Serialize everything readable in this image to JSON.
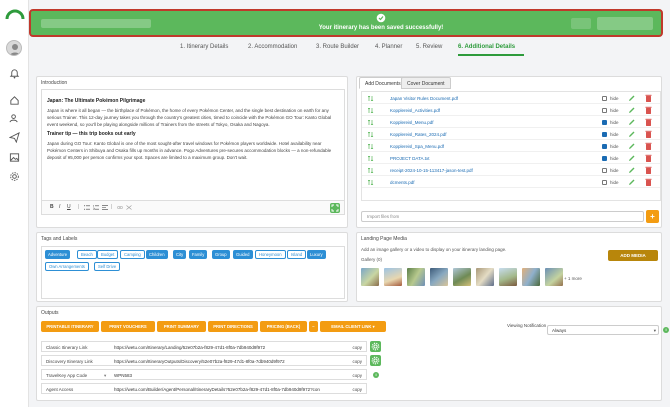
{
  "toast": {
    "message": "Your itinerary has been saved successfully!"
  },
  "steps": [
    {
      "label": "1. Itinerary Details"
    },
    {
      "label": "2. Accommodation"
    },
    {
      "label": "3. Route Builder"
    },
    {
      "label": "4. Planner"
    },
    {
      "label": "5. Review"
    },
    {
      "label": "6. Additional Details"
    }
  ],
  "introduction": {
    "title": "Introduction",
    "heading": "Japan: The Ultimate Pokémon Pilgrimage",
    "para1": "Japan is where it all began — the birthplace of Pokémon, the home of every Pokémon Center, and the single best destination on earth for any serious Trainer. This 12-day journey takes you through the country's greatest cities, timed to coincide with the Pokémon GO Tour: Kanto Global event weekend, so you'll be playing alongside millions of Trainers from the streets of Tokyo, Osaka and Nagoya.",
    "heading2": "Trainer tip — this trip books out early",
    "para2": "Japan during GO Tour: Kanto Global is one of the most sought-after travel windows for Pokémon players worldwide. Hotel availability near Pokémon Centers in Shibuya and Osaka fills up months in advance. Pogo Adventures pre-secures accommodation blocks — a non-refundable deposit of ¥5,000 per person confirms your spot. Spaces are limited to a maximum group. Don't wait."
  },
  "documents": {
    "tab_add": "Add Documents",
    "tab_cover": "Cover Document",
    "hide_label": "hide",
    "items": [
      {
        "name": "Japan Visitor Rules Document.pdf",
        "hidden": false
      },
      {
        "name": "Kopplereisl_Activities.pdf",
        "hidden": false
      },
      {
        "name": "Kopplereisl_Menu.pdf",
        "hidden": true
      },
      {
        "name": "Kopplereisl_Rates_2024.pdf",
        "hidden": true
      },
      {
        "name": "Kopplereisl_Spa_Menu.pdf",
        "hidden": true
      },
      {
        "name": "PROJECT DATA.txt",
        "hidden": true
      },
      {
        "name": "receipt-2024-10-15-113417-jason-test.pdf",
        "hidden": false
      },
      {
        "name": "dcments.pdf",
        "hidden": false
      }
    ],
    "import_placeholder": "Import files from",
    "import_button": "+"
  },
  "tags": {
    "title": "Tags and Labels",
    "items": [
      {
        "label": "Adventure",
        "selected": true
      },
      {
        "label": "Beach",
        "selected": false
      },
      {
        "label": "Budget",
        "selected": false
      },
      {
        "label": "Camping",
        "selected": false
      },
      {
        "label": "Children",
        "selected": true
      },
      {
        "label": "City",
        "selected": true
      },
      {
        "label": "Family",
        "selected": true
      },
      {
        "label": "Group",
        "selected": true
      },
      {
        "label": "Guided",
        "selected": true
      },
      {
        "label": "Honeymoon",
        "selected": false
      },
      {
        "label": "Island",
        "selected": false
      },
      {
        "label": "Luxury",
        "selected": true
      },
      {
        "label": "Own Arrangements",
        "selected": false
      },
      {
        "label": "Self Drive",
        "selected": false
      }
    ]
  },
  "landing": {
    "title": "Landing Page Media",
    "description": "Add an image gallery or a video to display on your itinerary landing page.",
    "gallery_label": "Gallery (0)",
    "add_button": "ADD MEDIA",
    "more": "+ 1 more"
  },
  "outputs": {
    "title": "Outputs",
    "buttons": [
      {
        "label": "PRINTABLE ITINERARY"
      },
      {
        "label": "PRINT VOUCHERS"
      },
      {
        "label": "PRINT SUMMARY"
      },
      {
        "label": "PRINT DIRECTIONS"
      },
      {
        "label": "PRICING (BACK)"
      },
      {
        "label": "−"
      },
      {
        "label": "EMAIL CLIENT LINK"
      }
    ],
    "rows": [
      {
        "label": "Classic Itinerary Link",
        "value": "https://wetu.com/Itinerary/Landing/52e07b2a-f829-47d1-8f0a-7db940d9f972",
        "copy": "copy"
      },
      {
        "label": "Discovery Itinerary Link",
        "value": "https://wetu.com/ItineraryOutputs/Discovery/52e07b2a-f829-47d1-8f0a-7db940d9f972",
        "copy": "copy"
      },
      {
        "label": "TravelKey App Code",
        "value": "WPN583",
        "copy": "copy"
      },
      {
        "label": "Agent Access",
        "value": "https://wetu.com/Builder/Agent/Personal/ItineraryDetails?52e07b2a-f829-47d1-8f0a-7db940d9f972?con",
        "copy": "copy"
      }
    ],
    "viewing_label": "Viewing Notification",
    "viewing_value": "Always"
  },
  "colors": {
    "success_green": "#5cb85c",
    "tag_blue": "#2d8fd5",
    "output_orange": "#f39c12",
    "media_gold": "#b8860b",
    "alert_red": "#c0392b"
  }
}
